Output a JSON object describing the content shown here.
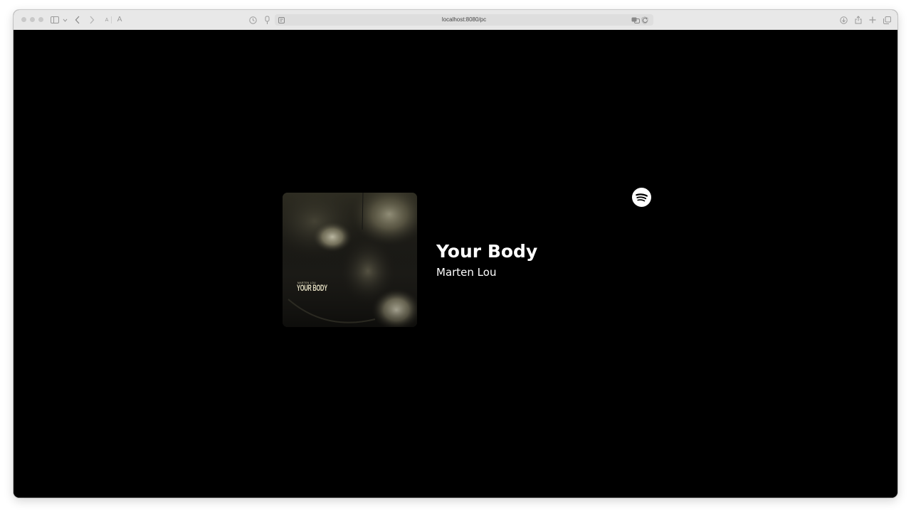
{
  "browser": {
    "url": "localhost:8080/pc",
    "text_size_small": "A",
    "text_size_large": "A",
    "icons": [
      "sidebar-icon",
      "chevron-down-icon",
      "back-icon",
      "forward-icon",
      "privacy-report-icon",
      "extension-icon",
      "page-settings-icon",
      "translate-icon",
      "reload-icon",
      "shield-icon",
      "download-icon",
      "share-icon",
      "new-tab-icon",
      "tab-overview-icon"
    ]
  },
  "player": {
    "track_title": "Your Body",
    "artist": "Marten Lou",
    "cover": {
      "artist_text": "MARTEN LOU",
      "title_text": "YOUR BODY"
    },
    "service_icon": "spotify-icon"
  },
  "colors": {
    "background": "#000000",
    "text": "#ffffff",
    "toolbar": "#e8e8e8"
  }
}
